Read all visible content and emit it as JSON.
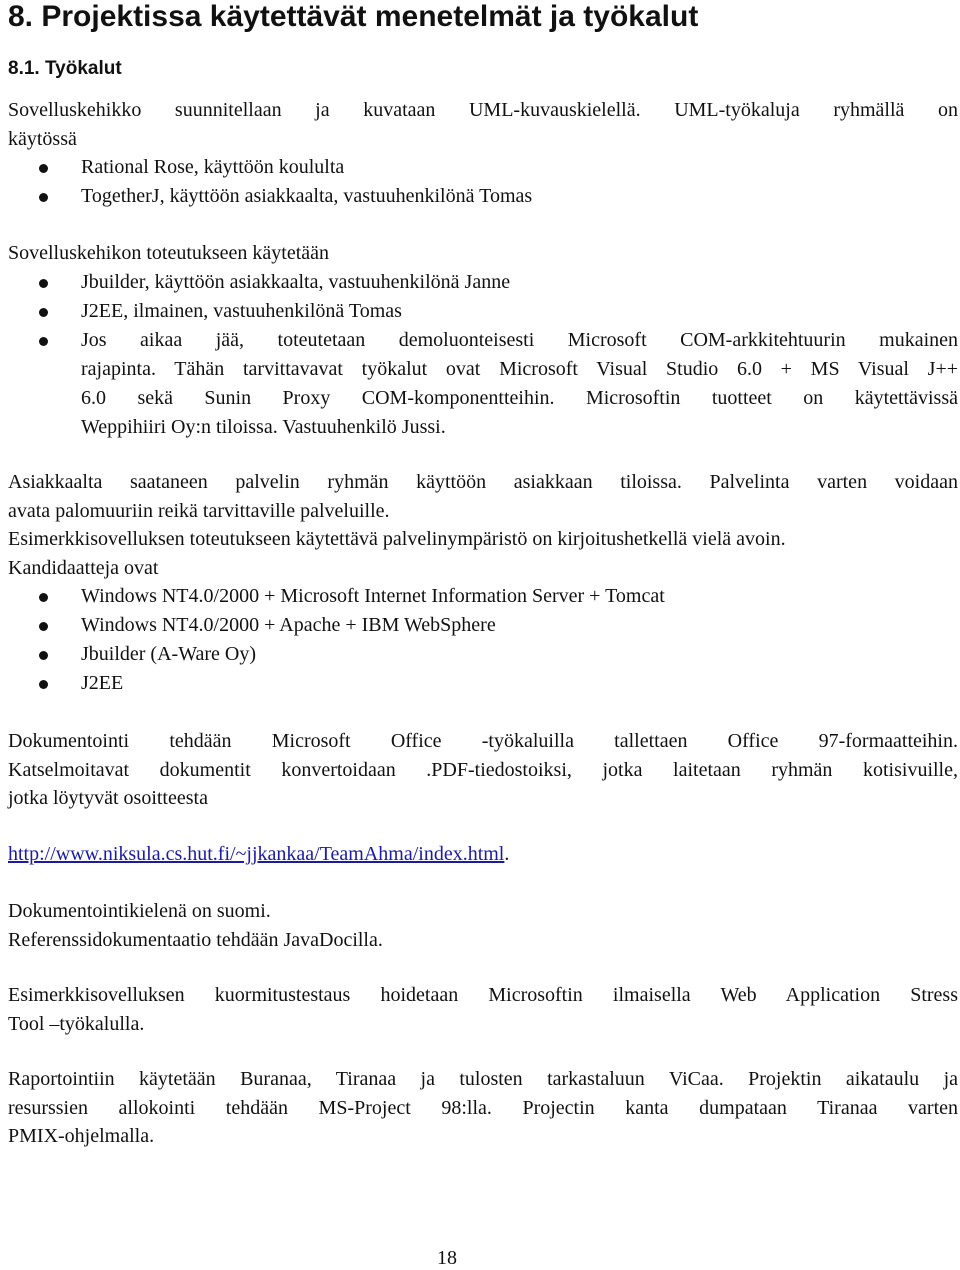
{
  "heading": "8. Projektissa käytettävät menetelmät ja työkalut",
  "subheading": "8.1. Työkalut",
  "intro": {
    "line1": "Sovelluskehikko suunnitellaan ja kuvataan UML-kuvauskielellä. UML-työkaluja ryhmällä on",
    "line2": "käytössä"
  },
  "uml_tools": [
    "Rational Rose, käyttöön koululta",
    "TogetherJ, käyttöön asiakkaalta, vastuuhenkilönä Tomas"
  ],
  "impl_intro": "Sovelluskehikon toteutukseen käytetään",
  "impl_tools": [
    {
      "lines": [
        "Jbuilder, käyttöön asiakkaalta, vastuuhenkilönä Janne"
      ]
    },
    {
      "lines": [
        "J2EE, ilmainen, vastuuhenkilönä Tomas"
      ]
    },
    {
      "lines": [
        "Jos aikaa jää, toteutetaan demoluonteisesti Microsoft COM-arkkitehtuurin mukainen",
        "rajapinta. Tähän tarvittavavat työkalut ovat Microsoft Visual Studio 6.0 + MS Visual J++",
        "6.0 sekä Sunin Proxy COM-komponentteihin. Microsoftin tuotteet on käytettävissä",
        "Weppihiiri Oy:n tiloissa. Vastuuhenkilö Jussi."
      ]
    }
  ],
  "server_para": {
    "line1": "Asiakkaalta saataneen palvelin ryhmän käyttöön asiakkaan tiloissa. Palvelinta varten voidaan",
    "line2": "avata palomuuriin reikä tarvittaville palveluille.",
    "line3": "Esimerkkisovelluksen toteutukseen käytettävä palvelinympäristö on kirjoitushetkellä vielä avoin.",
    "line4": "Kandidaatteja ovat"
  },
  "candidates": [
    "Windows NT4.0/2000 + Microsoft Internet Information Server + Tomcat",
    "Windows NT4.0/2000 + Apache + IBM WebSphere",
    "Jbuilder (A-Ware Oy)",
    "J2EE"
  ],
  "doc_para": {
    "line1": "Dokumentointi tehdään Microsoft Office -työkaluilla tallettaen Office 97-formaatteihin.",
    "line2": "Katselmoitavat dokumentit konvertoidaan .PDF-tiedostoiksi, jotka laitetaan ryhmän kotisivuille,",
    "line3": "jotka löytyvät osoitteesta"
  },
  "link": {
    "url_text": "http://www.niksula.cs.hut.fi/~jjkankaa/TeamAhma/index.html",
    "trailing": "."
  },
  "lang_para": {
    "line1": "Dokumentointikielenä on suomi.",
    "line2": "Referenssidokumentaatio tehdään JavaDocilla."
  },
  "stress_para": {
    "line1": "Esimerkkisovelluksen kuormitustestaus hoidetaan Microsoftin ilmaisella Web Application Stress",
    "line2": "Tool –työkalulla."
  },
  "report_para": {
    "line1": "Raportointiin käytetään Buranaa, Tiranaa ja tulosten tarkastaluun ViCaa. Projektin aikataulu ja",
    "line2": "resurssien allokointi tehdään MS-Project 98:lla. Projectin kanta dumpataan Tiranaa varten",
    "line3": "PMIX-ohjelmalla."
  },
  "page_number": "18",
  "colors": {
    "text": "#111111",
    "link": "#1a1aa6",
    "background": "#ffffff"
  }
}
